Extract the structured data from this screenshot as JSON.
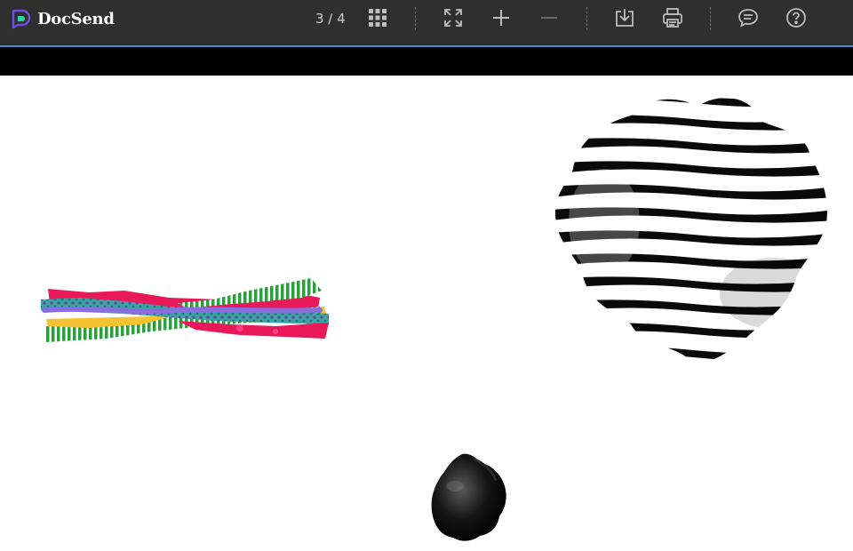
{
  "app": {
    "brand_name": "DocSend",
    "brand_colors": [
      "#6c4ee6",
      "#2ed3a4"
    ]
  },
  "toolbar": {
    "page_indicator": "3 / 4",
    "icons": [
      "grid-view-icon",
      "fullscreen-icon",
      "zoom-in-icon",
      "zoom-out-icon",
      "download-icon",
      "print-icon",
      "comment-icon",
      "help-icon"
    ],
    "accent_color": "#3b8fd6"
  },
  "document": {
    "current_page": 3,
    "total_pages": 4,
    "illustrations": [
      "colorful-torn-paper-collage",
      "black-white-striped-blob",
      "black-helmet-object"
    ]
  }
}
